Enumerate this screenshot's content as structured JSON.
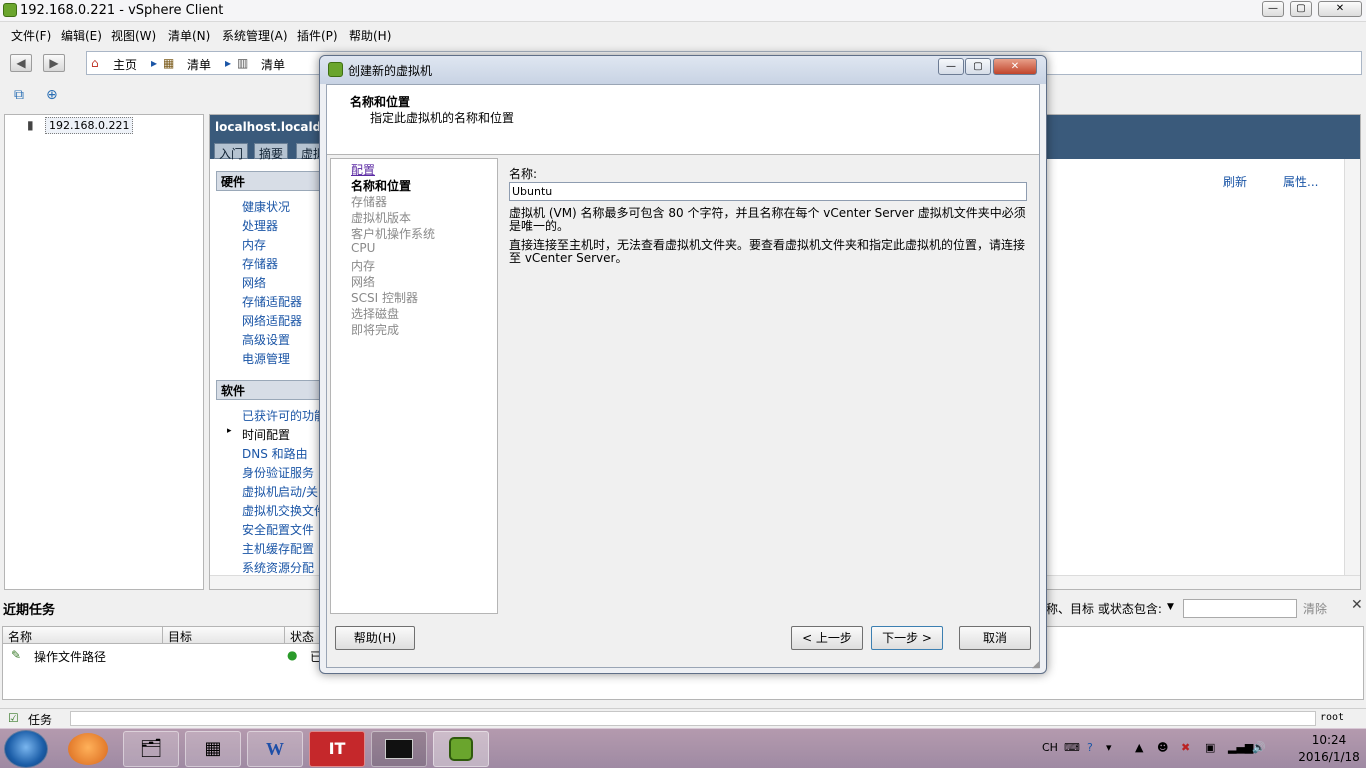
{
  "window": {
    "title": "192.168.0.221 - vSphere Client"
  },
  "menu": [
    "文件(F)",
    "编辑(E)",
    "视图(W)",
    "清单(N)",
    "系统管理(A)",
    "插件(P)",
    "帮助(H)"
  ],
  "breadcrumb": [
    "主页",
    "清单",
    "清单"
  ],
  "tree": {
    "node": "192.168.0.221"
  },
  "host_panel": {
    "title": "localhost.localdom",
    "tabs": [
      "入门",
      "摘要",
      "虚拟"
    ],
    "hardware_header": "硬件",
    "hardware_items": [
      "健康状况",
      "处理器",
      "内存",
      "存储器",
      "网络",
      "存储适配器",
      "网络适配器",
      "高级设置",
      "电源管理"
    ],
    "software_header": "软件",
    "software_items": [
      "已获许可的功能",
      "时间配置",
      "DNS 和路由",
      "身份验证服务",
      "虚拟机启动/关",
      "虚拟机交换文件",
      "安全配置文件",
      "主机缓存配置",
      "系统资源分配"
    ],
    "refresh": "刷新",
    "properties": "属性..."
  },
  "recent_tasks": {
    "title": "近期任务",
    "filter_label": "称、目标 或状态包含:",
    "clear": "清除",
    "columns": [
      "名称",
      "目标",
      "状态"
    ],
    "rows": [
      {
        "name": "操作文件路径",
        "status": "已"
      }
    ]
  },
  "statusbar": {
    "tasks": "任务",
    "user": "root"
  },
  "dialog": {
    "title": "创建新的虚拟机",
    "header_title": "名称和位置",
    "header_subtitle": "指定此虚拟机的名称和位置",
    "steps": [
      {
        "label": "配置",
        "state": "done"
      },
      {
        "label": "名称和位置",
        "state": "current"
      },
      {
        "label": "存储器",
        "state": "pending"
      },
      {
        "label": "虚拟机版本",
        "state": "pending"
      },
      {
        "label": "客户机操作系统",
        "state": "pending"
      },
      {
        "label": "CPU",
        "state": "pending"
      },
      {
        "label": "内存",
        "state": "pending"
      },
      {
        "label": "网络",
        "state": "pending"
      },
      {
        "label": "SCSI 控制器",
        "state": "pending"
      },
      {
        "label": "选择磁盘",
        "state": "pending"
      },
      {
        "label": "即将完成",
        "state": "pending"
      }
    ],
    "name_label": "名称:",
    "name_value": "Ubuntu",
    "desc1": "虚拟机 (VM) 名称最多可包含 80 个字符，并且名称在每个 vCenter Server 虚拟机文件夹中必须是唯一的。",
    "desc2": "直接连接至主机时，无法查看虚拟机文件夹。要查看虚拟机文件夹和指定此虚拟机的位置，请连接至 vCenter Server。",
    "buttons": {
      "help": "帮助(H)",
      "back": "< 上一步",
      "next": "下一步 >",
      "cancel": "取消"
    }
  },
  "taskbar": {
    "tray_lang": "CH",
    "time": "10:24",
    "date": "2016/1/18"
  }
}
